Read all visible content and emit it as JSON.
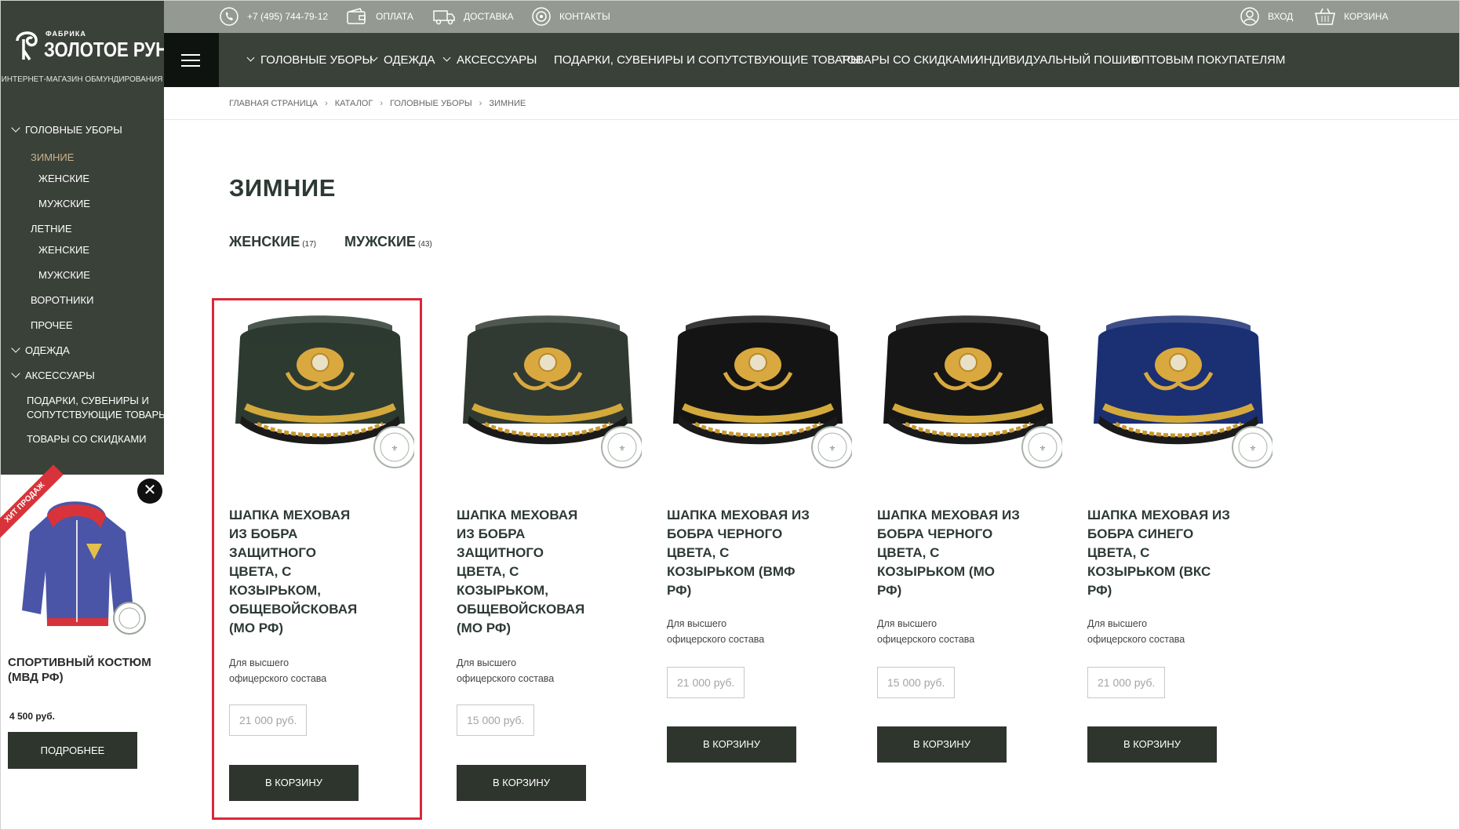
{
  "logo": {
    "small": "ФАБРИКА",
    "big": "ЗОЛОТОЕ РУНО",
    "tagline": "ИНТЕРНЕТ-МАГАЗИН ОБМУНДИРОВАНИЯ"
  },
  "topbar": {
    "phone": "+7 (495) 744-79-12",
    "payment": "ОПЛАТА",
    "delivery": "ДОСТАВКА",
    "contacts": "КОНТАКТЫ",
    "login": "ВХОД",
    "cart": "КОРЗИНА"
  },
  "mainnav": {
    "items": [
      "ГОЛОВНЫЕ УБОРЫ",
      "ОДЕЖДА",
      "АКСЕССУАРЫ",
      "ПОДАРКИ, СУВЕНИРЫ И СОПУТСТВУЮЩИЕ ТОВАРЫ",
      "ТОВАРЫ СО СКИДКАМИ",
      "ИНДИВИДУАЛЬНЫЙ ПОШИВ",
      "ОПТОВЫМ ПОКУПАТЕЛЯМ"
    ]
  },
  "sidebar": {
    "items": [
      "ГОЛОВНЫЕ УБОРЫ",
      "ЗИМНИЕ",
      "ЖЕНСКИЕ",
      "МУЖСКИЕ",
      "ЛЕТНИЕ",
      "ЖЕНСКИЕ",
      "МУЖСКИЕ",
      "ВОРОТНИКИ",
      "ПРОЧЕЕ",
      "ОДЕЖДА",
      "АКСЕССУАРЫ",
      "ПОДАРКИ, СУВЕНИРЫ И",
      "СОПУТСТВУЮЩИЕ ТОВАРЫ",
      "ТОВАРЫ СО СКИДКАМИ"
    ]
  },
  "promo": {
    "ribbon": "ХИТ ПРОДАЖ",
    "close": "✕",
    "title": "СПОРТИВНЫЙ КОСТЮМ (МВД РФ)",
    "price": "4 500 руб.",
    "button": "ПОДРОБНЕЕ"
  },
  "breadcrumb": [
    "ГЛАВНАЯ СТРАНИЦА",
    "КАТАЛОГ",
    "ГОЛОВНЫЕ УБОРЫ",
    "ЗИМНИЕ"
  ],
  "page": {
    "title": "ЗИМНИЕ",
    "subcats": [
      {
        "label": "ЖЕНСКИЕ",
        "count": "(17)"
      },
      {
        "label": "МУЖСКИЕ",
        "count": "(43)"
      }
    ]
  },
  "products": [
    {
      "title": "ШАПКА МЕХОВАЯ ИЗ БОБРА ЗАЩИТНОГО ЦВЕТА, С КОЗЫРЬКОМ, ОБЩЕВОЙСКОВАЯ (МО РФ)",
      "desc": "Для высшего офицерского состава",
      "price": "21 000 руб.",
      "button": "В КОРЗИНУ",
      "color": "#2d3a30"
    },
    {
      "title": "ШАПКА МЕХОВАЯ ИЗ БОБРА ЗАЩИТНОГО ЦВЕТА, С КОЗЫРЬКОМ, ОБЩЕВОЙСКОВАЯ (МО РФ)",
      "desc": "Для высшего офицерского состава",
      "price": "15 000 руб.",
      "button": "В КОРЗИНУ",
      "color": "#303a32"
    },
    {
      "title": "ШАПКА МЕХОВАЯ ИЗ БОБРА ЧЕРНОГО ЦВЕТА, С КОЗЫРЬКОМ (ВМФ РФ)",
      "desc": "Для высшего офицерского состава",
      "price": "21 000 руб.",
      "button": "В КОРЗИНУ",
      "color": "#141414"
    },
    {
      "title": "ШАПКА МЕХОВАЯ ИЗ БОБРА ЧЕРНОГО ЦВЕТА, С КОЗЫРЬКОМ (МО РФ)",
      "desc": "Для высшего офицерского состава",
      "price": "15 000 руб.",
      "button": "В КОРЗИНУ",
      "color": "#161616"
    },
    {
      "title": "ШАПКА МЕХОВАЯ ИЗ БОБРА СИНЕГО ЦВЕТА, С КОЗЫРЬКОМ (ВКС РФ)",
      "desc": "Для высшего офицерского состава",
      "price": "21 000 руб.",
      "button": "В КОРЗИНУ",
      "color": "#1b2f73"
    }
  ],
  "colors": {
    "dark_green": "#3a4139",
    "topbar": "#949a91",
    "button": "#2e352d",
    "accent_red": "#d9283a",
    "active_link": "#c9b28a"
  }
}
